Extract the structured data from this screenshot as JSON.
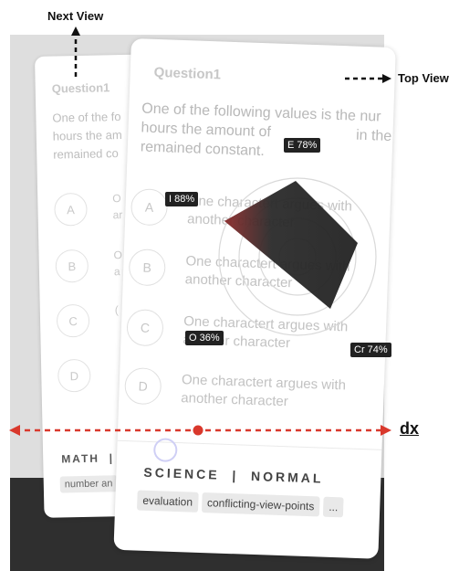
{
  "annotations": {
    "next_view": "Next View",
    "top_view": "Top View",
    "dx": "dx"
  },
  "back_card": {
    "question_title": "Question1",
    "question_text": "One of the fo\nhours the am\nremained co",
    "options": [
      {
        "letter": "A",
        "text": "O\nar"
      },
      {
        "letter": "B",
        "text": "O\na"
      },
      {
        "letter": "C",
        "text": "("
      },
      {
        "letter": "D",
        "text": ""
      }
    ],
    "category": "MATH  |",
    "tag": "number an"
  },
  "front_card": {
    "question_title": "Question1",
    "question_text": "One of the following values is the nur\nhours the amount of                     in the pon\nremained constant.",
    "options": [
      {
        "letter": "A",
        "text": "One charactert argues with\nanother character"
      },
      {
        "letter": "B",
        "text": "One charactert argues with\nanother character"
      },
      {
        "letter": "C",
        "text": "One charactert argues with\nanother character"
      },
      {
        "letter": "D",
        "text": "One charactert argues with\nanother character"
      }
    ],
    "category": "SCIENCE  |  NORMAL",
    "tags": [
      "evaluation",
      "conflicting-view-points",
      "..."
    ]
  },
  "radar": {
    "labels": [
      {
        "id": "E",
        "text": "E 78%"
      },
      {
        "id": "I",
        "text": "I 88%"
      },
      {
        "id": "O",
        "text": "O 36%"
      },
      {
        "id": "Cr",
        "text": "Cr 74%"
      }
    ],
    "fill_color": "#222222",
    "accent_color": "#8b2b2b"
  },
  "colors": {
    "arrow_red": "#d9382c",
    "backdrop_light": "#dedede",
    "backdrop_dark": "#2f2f2f"
  }
}
